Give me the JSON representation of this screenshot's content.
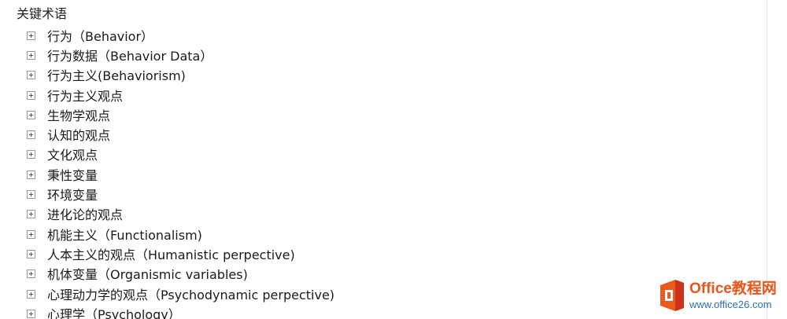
{
  "tree": {
    "title": "关键术语",
    "items": [
      {
        "label": "行为（Behavior）"
      },
      {
        "label": "行为数据（Behavior Data）"
      },
      {
        "label": "行为主义(Behaviorism)"
      },
      {
        "label": "行为主义观点"
      },
      {
        "label": "生物学观点"
      },
      {
        "label": "认知的观点"
      },
      {
        "label": "文化观点"
      },
      {
        "label": "秉性变量"
      },
      {
        "label": "环境变量"
      },
      {
        "label": "进化论的观点"
      },
      {
        "label": "机能主义（Functionalism)"
      },
      {
        "label": "人本主义的观点（Humanistic perpective)"
      },
      {
        "label": "机体变量（Organismic variables)"
      },
      {
        "label": "心理动力学的观点（Psychodynamic perpective)"
      },
      {
        "label": "心理学（Psychology）"
      }
    ]
  },
  "watermark": {
    "brand": "Office教程网",
    "url": "www.office26.com",
    "logo_icon": "office-logo-icon",
    "colors": {
      "brand": "#e8561c",
      "url": "#2f6fb5",
      "logo_orange": "#ea5a1f",
      "logo_red": "#c9331a"
    }
  }
}
